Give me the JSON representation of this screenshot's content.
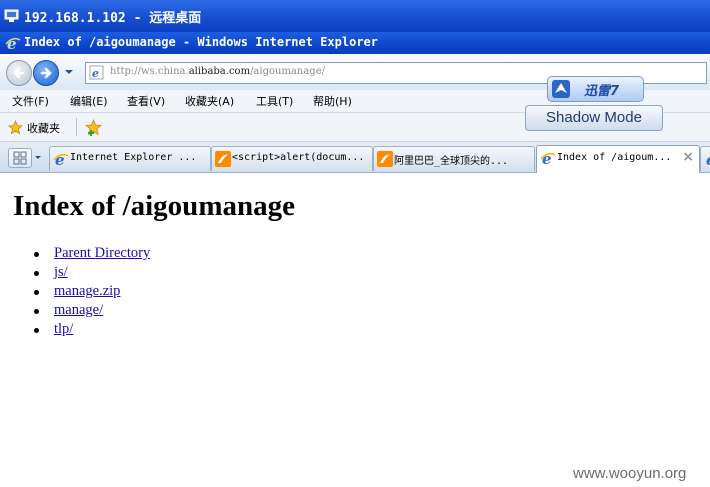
{
  "rdp_window": {
    "title": "192.168.1.102 - 远程桌面"
  },
  "ie_window": {
    "title": "Index of /aigoumanage - Windows Internet Explorer"
  },
  "address_bar": {
    "url_prefix": "http://ws.china.",
    "url_domain": "alibaba.com",
    "url_path": "/aigoumanage/"
  },
  "menu": {
    "items": [
      {
        "label": "文件(F)"
      },
      {
        "label": "编辑(E)"
      },
      {
        "label": "查看(V)"
      },
      {
        "label": "收藏夹(A)"
      },
      {
        "label": "工具(T)"
      },
      {
        "label": "帮助(H)"
      }
    ]
  },
  "favorites_bar": {
    "label": "收藏夹"
  },
  "overlay": {
    "xunlei_label": "迅雷7",
    "shadow_mode_label": "Shadow Mode"
  },
  "tabs": [
    {
      "label": "Internet Explorer ...",
      "icon": "ie-icon"
    },
    {
      "label": "<script>alert(docum...",
      "icon": "alibaba-icon"
    },
    {
      "label": "阿里巴巴_全球顶尖的...",
      "icon": "alibaba-icon"
    },
    {
      "label": "Index of /aigoum...",
      "icon": "ie-icon",
      "active": true,
      "close": "×"
    }
  ],
  "page": {
    "heading": "Index of /aigoumanage",
    "links": [
      {
        "label": "Parent Directory"
      },
      {
        "label": "js/"
      },
      {
        "label": "manage.zip"
      },
      {
        "label": "manage/"
      },
      {
        "label": "tlp/"
      }
    ]
  },
  "watermark": "www.wooyun.org",
  "colors": {
    "title_bar": "#1a53d4",
    "link": "#1a0dab",
    "toolbar_bg": "#f1f4f9"
  }
}
